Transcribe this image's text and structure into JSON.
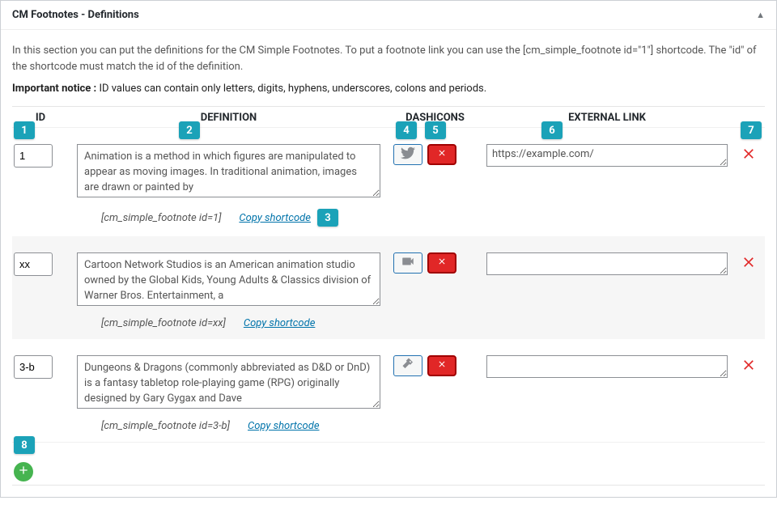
{
  "header": {
    "title": "CM Footnotes - Definitions"
  },
  "intro": "In this section you can put the definitions for the CM Simple Footnotes. To put a footnote link you can use the [cm_simple_footnote id=\"1\"] shortcode. The \"id\" of the shortcode must match the id of the definition.",
  "notice_label": "Important notice :",
  "notice_text": " ID values can contain only letters, digits, hyphens, underscores, colons and periods.",
  "columns": {
    "id": "ID",
    "definition": "DEFINITION",
    "dashicons": "DASHICONS",
    "external": "EXTERNAL LINK"
  },
  "copy_label": "Copy shortcode",
  "rows": [
    {
      "id": "1",
      "definition": "Animation is a method in which figures are manipulated to appear as moving images. In traditional animation, images are drawn or painted by ",
      "icon": "twitter",
      "external": "https://example.com/",
      "shortcode": "[cm_simple_footnote id=1]"
    },
    {
      "id": "xx",
      "definition": "Cartoon Network Studios is an American animation studio owned by the Global Kids, Young Adults & Classics division of Warner Bros. Entertainment, a ",
      "icon": "video",
      "external": "",
      "shortcode": "[cm_simple_footnote id=xx]"
    },
    {
      "id": "3-b",
      "definition": "Dungeons & Dragons (commonly abbreviated as D&D or DnD) is a fantasy tabletop role-playing game (RPG) originally designed by Gary Gygax and Dave ",
      "icon": "hammer",
      "external": "",
      "shortcode": "[cm_simple_footnote id=3-b]"
    }
  ],
  "callouts": [
    "1",
    "2",
    "3",
    "4",
    "5",
    "6",
    "7",
    "8"
  ]
}
